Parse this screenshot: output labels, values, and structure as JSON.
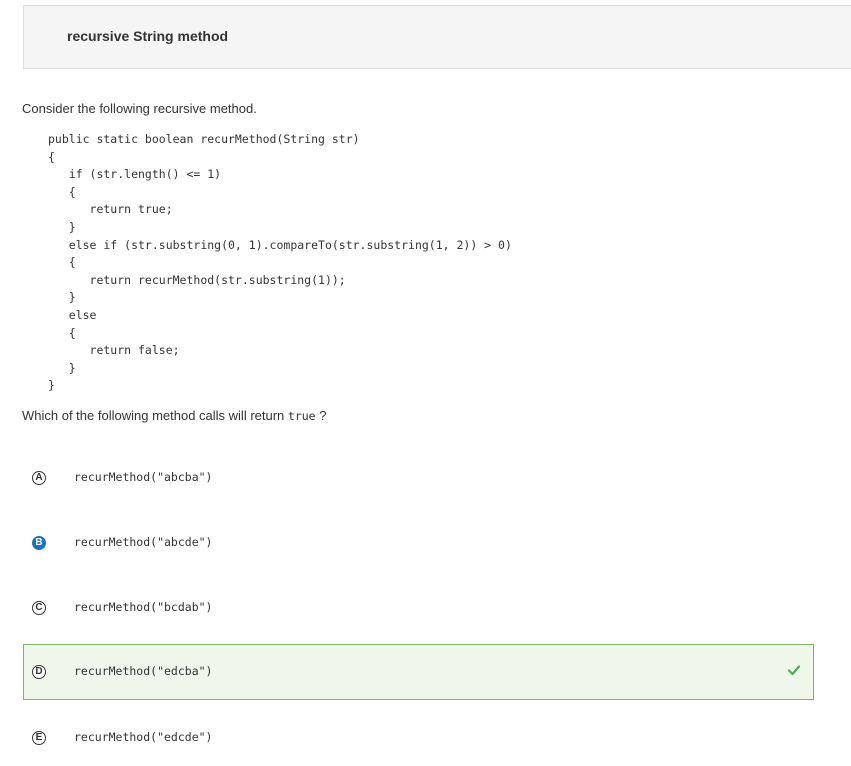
{
  "header": {
    "title": "recursive String method"
  },
  "prompt": "Consider the following recursive method.",
  "code_lines": [
    "public static boolean recurMethod(String str)",
    "{",
    "   if (str.length() <= 1)",
    "   {",
    "      return true;",
    "   }",
    "   else if (str.substring(0, 1).compareTo(str.substring(1, 2)) > 0)",
    "   {",
    "      return recurMethod(str.substring(1));",
    "   }",
    "   else",
    "   {",
    "      return false;",
    "   }",
    "}"
  ],
  "question": {
    "text": "Which of the following method calls will return",
    "code": "true",
    "suffix": "?"
  },
  "choices": [
    {
      "letter": "A",
      "text": "recurMethod(\"abcba\")",
      "selected": false,
      "correct": false
    },
    {
      "letter": "B",
      "text": "recurMethod(\"abcde\")",
      "selected": true,
      "correct": false
    },
    {
      "letter": "C",
      "text": "recurMethod(\"bcdab\")",
      "selected": false,
      "correct": false
    },
    {
      "letter": "D",
      "text": "recurMethod(\"edcba\")",
      "selected": false,
      "correct": true
    },
    {
      "letter": "E",
      "text": "recurMethod(\"edcde\")",
      "selected": false,
      "correct": false
    }
  ],
  "colors": {
    "selected": "#1a73c4",
    "correct_border": "#7bb661",
    "correct_background": "#eef7ea",
    "check": "#4caf50"
  },
  "icons": {
    "correct": "check-icon"
  }
}
